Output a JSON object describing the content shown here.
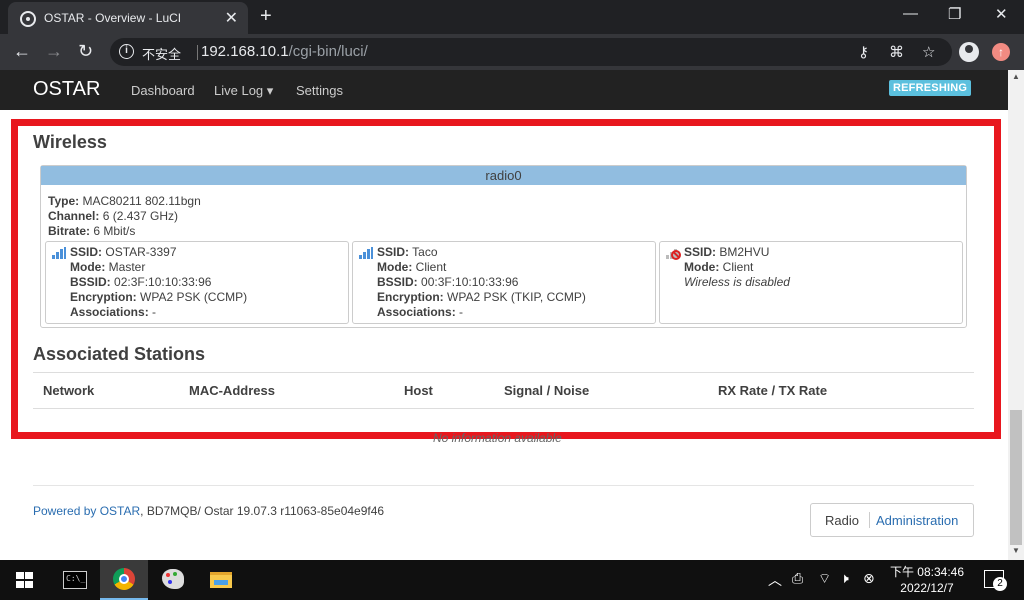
{
  "browser": {
    "tab_title": "OSTAR - Overview - LuCI",
    "tab_close": "✕",
    "new_tab": "+",
    "insecure_label": "不安全",
    "url_host": "192.168.10.1",
    "url_path": "/cgi-bin/luci/",
    "update_badge": "↑"
  },
  "nav": {
    "brand": "OSTAR",
    "items": [
      "Dashboard",
      "Live Log ▾",
      "Settings"
    ],
    "status": "REFRESHING"
  },
  "wireless": {
    "heading": "Wireless",
    "radio_name": "radio0",
    "type_label": "Type:",
    "type_value": "MAC80211 802.11bgn",
    "channel_label": "Channel:",
    "channel_value": "6 (2.437 GHz)",
    "bitrate_label": "Bitrate:",
    "bitrate_value": "6 Mbit/s",
    "networks": [
      {
        "ssid_label": "SSID:",
        "ssid": "OSTAR-3397",
        "mode_label": "Mode:",
        "mode": "Master",
        "bssid_label": "BSSID:",
        "bssid": "02:3F:10:10:33:96",
        "enc_label": "Encryption:",
        "enc": "WPA2 PSK (CCMP)",
        "assoc_label": "Associations:",
        "assoc": "-"
      },
      {
        "ssid_label": "SSID:",
        "ssid": "Taco",
        "mode_label": "Mode:",
        "mode": "Client",
        "bssid_label": "BSSID:",
        "bssid": "00:3F:10:10:33:96",
        "enc_label": "Encryption:",
        "enc": "WPA2 PSK (TKIP, CCMP)",
        "assoc_label": "Associations:",
        "assoc": "-"
      },
      {
        "ssid_label": "SSID:",
        "ssid": "BM2HVU",
        "mode_label": "Mode:",
        "mode": "Client",
        "status": "Wireless is disabled"
      }
    ]
  },
  "stations": {
    "heading": "Associated Stations",
    "columns": [
      "Network",
      "MAC-Address",
      "Host",
      "Signal / Noise",
      "RX Rate / TX Rate"
    ],
    "empty_text": "No information available"
  },
  "footer": {
    "powered_link": "Powered by OSTAR",
    "powered_rest": ", BD7MQB/ Ostar 19.07.3 r11063-85e04e9f46",
    "btn_radio": "Radio",
    "btn_admin": "Administration"
  },
  "taskbar": {
    "time": "下午 08:34:46",
    "date": "2022/12/7",
    "notification_count": "2"
  }
}
